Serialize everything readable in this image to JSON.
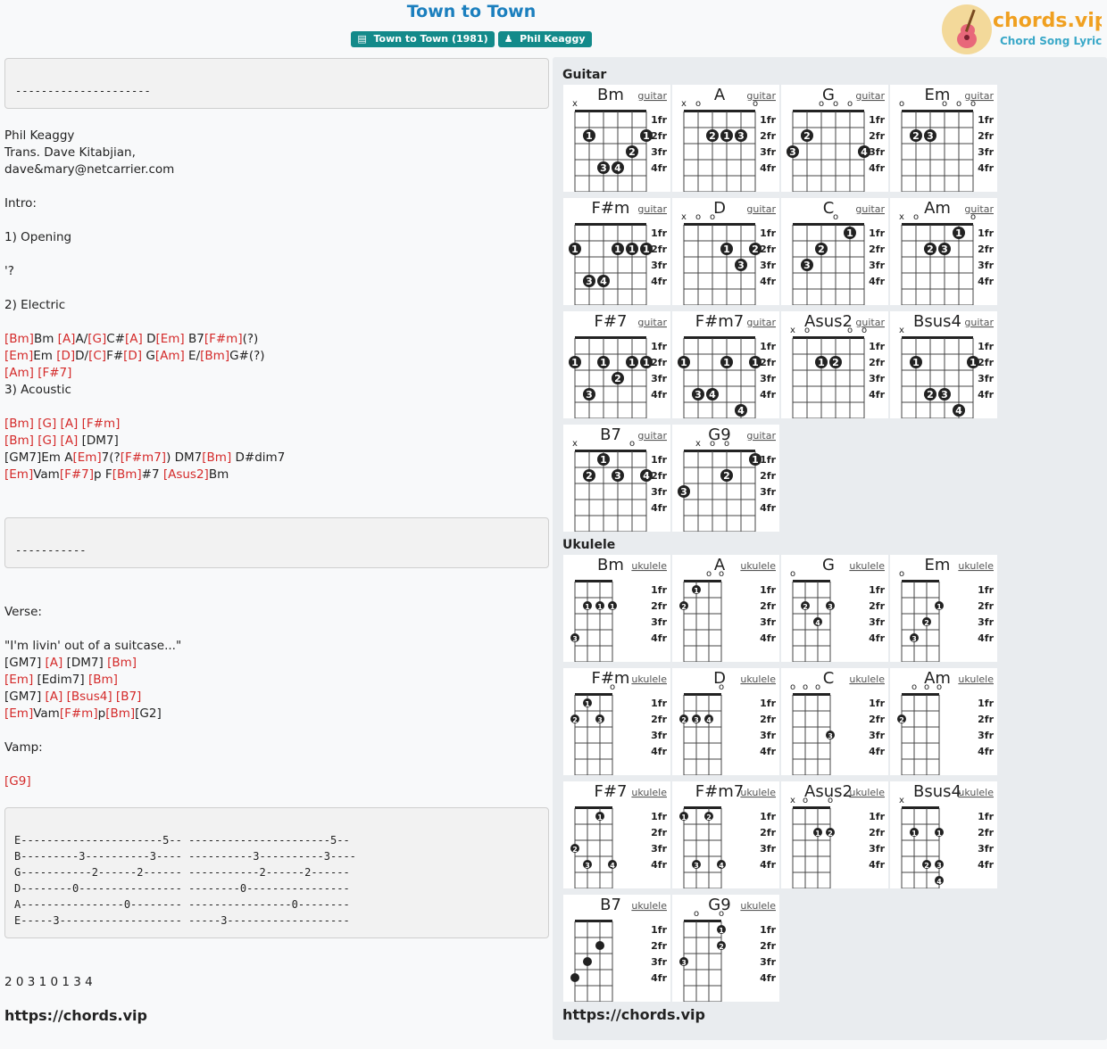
{
  "page": {
    "title": "Town to Town",
    "badges": [
      "Town to Town (1981)",
      "Phil Keaggy"
    ],
    "logo": {
      "name": "chords.vip",
      "tagline": "Chord Song Lyric"
    },
    "footer_url": "https://chords.vip"
  },
  "content": {
    "box1": "---------------------",
    "header_lines": [
      "Phil Keaggy",
      "Trans. Dave Kitabjian,",
      "dave&mary@netcarrier.com",
      "",
      "Intro:",
      "",
      "1) Opening",
      "",
      "'?",
      "",
      "2) Electric"
    ],
    "intro_chord_lines": [
      [
        [
          "[Bm]",
          1
        ],
        [
          "Bm ",
          0
        ],
        [
          "[A]",
          1
        ],
        [
          "A/",
          0
        ],
        [
          "[G]",
          1
        ],
        [
          "C#",
          0
        ],
        [
          "[A]",
          1
        ],
        [
          " D",
          0
        ],
        [
          "[Em]",
          1
        ],
        [
          " B7",
          0
        ],
        [
          "[F#m]",
          1
        ],
        [
          "(?)",
          0
        ]
      ],
      [
        [
          "[Em]",
          1
        ],
        [
          "Em ",
          0
        ],
        [
          "[D]",
          1
        ],
        [
          "D/",
          0
        ],
        [
          "[C]",
          1
        ],
        [
          "F#",
          0
        ],
        [
          "[D]",
          1
        ],
        [
          " G",
          0
        ],
        [
          "[Am]",
          1
        ],
        [
          " E/",
          0
        ],
        [
          "[Bm]",
          1
        ],
        [
          "G#(?)",
          0
        ]
      ],
      [
        [
          "[Am]",
          1
        ],
        [
          " ",
          0
        ],
        [
          "[F#7]",
          1
        ]
      ],
      [
        [
          "3) Acoustic",
          0
        ]
      ],
      [
        [
          "",
          0
        ]
      ],
      [
        [
          "[Bm]",
          1
        ],
        [
          " ",
          0
        ],
        [
          "[G]",
          1
        ],
        [
          " ",
          0
        ],
        [
          "[A]",
          1
        ],
        [
          " ",
          0
        ],
        [
          "[F#m]",
          1
        ]
      ],
      [
        [
          "[Bm]",
          1
        ],
        [
          " ",
          0
        ],
        [
          "[G]",
          1
        ],
        [
          " ",
          0
        ],
        [
          "[A]",
          1
        ],
        [
          " [DM7]",
          0
        ]
      ],
      [
        [
          "[GM7]Em A",
          0
        ],
        [
          "[Em]",
          1
        ],
        [
          "7(?",
          0
        ],
        [
          "[F#m7]",
          1
        ],
        [
          ") DM7",
          0
        ],
        [
          "[Bm]",
          1
        ],
        [
          " D#dim7",
          0
        ]
      ],
      [
        [
          "[Em]",
          1
        ],
        [
          "Vam",
          0
        ],
        [
          "[F#7]",
          1
        ],
        [
          "p F",
          0
        ],
        [
          "[Bm]",
          1
        ],
        [
          "#7 ",
          0
        ],
        [
          "[Asus2]",
          1
        ],
        [
          "Bm",
          0
        ]
      ]
    ],
    "box2": "-----------",
    "verse_lines": [
      [
        [
          "Verse:",
          0
        ]
      ],
      [
        [
          "",
          0
        ]
      ],
      [
        [
          "\"I'm livin' out of a suitcase...\"",
          0
        ]
      ],
      [
        [
          "[GM7] ",
          0
        ],
        [
          "[A]",
          1
        ],
        [
          " [DM7] ",
          0
        ],
        [
          "[Bm]",
          1
        ]
      ],
      [
        [
          "[Em]",
          1
        ],
        [
          " [Edim7] ",
          0
        ],
        [
          "[Bm]",
          1
        ]
      ],
      [
        [
          "[GM7] ",
          0
        ],
        [
          "[A]",
          1
        ],
        [
          " ",
          0
        ],
        [
          "[Bsus4]",
          1
        ],
        [
          " ",
          0
        ],
        [
          "[B7]",
          1
        ]
      ],
      [
        [
          "[Em]",
          1
        ],
        [
          "Vam",
          0
        ],
        [
          "[F#m]",
          1
        ],
        [
          "p",
          0
        ],
        [
          "[Bm]",
          1
        ],
        [
          "[G2]",
          0
        ]
      ],
      [
        [
          "",
          0
        ]
      ],
      [
        [
          "Vamp:",
          0
        ]
      ],
      [
        [
          "",
          0
        ]
      ],
      [
        [
          "[G9]",
          1
        ]
      ]
    ],
    "tab": [
      "E----------------------5-- ----------------------5--",
      "B---------3----------3---- ----------3----------3----",
      "G-----------2------2------ -----------2------2------",
      "D--------0---------------- --------0----------------",
      "A----------------0-------- ----------------0--------",
      "E-----3------------------- -----3-------------------"
    ],
    "fingering": "2 0 3 1 0 1 3 4"
  },
  "diagrams": {
    "guitar_label": "Guitar",
    "ukulele_label": "Ukulele",
    "fret_labels": [
      "1fr",
      "2fr",
      "3fr",
      "4fr"
    ],
    "guitar_link": "guitar",
    "ukulele_link": "ukulele",
    "guitar": [
      {
        "name": "Bm",
        "top": [
          "x",
          "",
          "",
          "",
          "",
          ""
        ],
        "dots": [
          [
            1,
            1,
            "1"
          ],
          [
            1,
            5,
            "1"
          ],
          [
            2,
            4,
            "2"
          ],
          [
            3,
            2,
            "3"
          ],
          [
            3,
            3,
            "4"
          ]
        ]
      },
      {
        "name": "A",
        "top": [
          "x",
          "o",
          "",
          "",
          "",
          "o"
        ],
        "dots": [
          [
            1,
            2,
            "2"
          ],
          [
            1,
            3,
            "1"
          ],
          [
            1,
            4,
            "3"
          ]
        ]
      },
      {
        "name": "G",
        "top": [
          "",
          "",
          "o",
          "o",
          "o",
          ""
        ],
        "dots": [
          [
            1,
            1,
            "2"
          ],
          [
            2,
            0,
            "3"
          ],
          [
            2,
            5,
            "4"
          ]
        ]
      },
      {
        "name": "Em",
        "top": [
          "o",
          "",
          "",
          "o",
          "o",
          "o"
        ],
        "dots": [
          [
            1,
            1,
            "2"
          ],
          [
            1,
            2,
            "3"
          ]
        ]
      },
      {
        "name": "F#m",
        "top": [
          "",
          "",
          "",
          "",
          "",
          ""
        ],
        "dots": [
          [
            1,
            0,
            "1"
          ],
          [
            1,
            3,
            "1"
          ],
          [
            1,
            4,
            "1"
          ],
          [
            1,
            5,
            "1"
          ],
          [
            3,
            1,
            "3"
          ],
          [
            3,
            2,
            "4"
          ]
        ]
      },
      {
        "name": "D",
        "top": [
          "x",
          "o",
          "o",
          "",
          "",
          ""
        ],
        "dots": [
          [
            1,
            3,
            "1"
          ],
          [
            1,
            5,
            "2"
          ],
          [
            2,
            4,
            "3"
          ]
        ]
      },
      {
        "name": "C",
        "top": [
          "",
          "",
          "",
          "o",
          "",
          ""
        ],
        "dots": [
          [
            0,
            4,
            "1"
          ],
          [
            1,
            2,
            "2"
          ],
          [
            2,
            1,
            "3"
          ]
        ]
      },
      {
        "name": "Am",
        "top": [
          "x",
          "o",
          "",
          "",
          "",
          "o"
        ],
        "dots": [
          [
            0,
            4,
            "1"
          ],
          [
            1,
            2,
            "2"
          ],
          [
            1,
            3,
            "3"
          ]
        ]
      },
      {
        "name": "F#7",
        "top": [
          "",
          "",
          "",
          "",
          "",
          ""
        ],
        "dots": [
          [
            1,
            0,
            "1"
          ],
          [
            1,
            2,
            "1"
          ],
          [
            1,
            4,
            "1"
          ],
          [
            1,
            5,
            "1"
          ],
          [
            2,
            3,
            "2"
          ],
          [
            3,
            1,
            "3"
          ]
        ]
      },
      {
        "name": "F#m7",
        "top": [
          "",
          "",
          "",
          "",
          "",
          ""
        ],
        "dots": [
          [
            1,
            0,
            "1"
          ],
          [
            1,
            3,
            "1"
          ],
          [
            1,
            5,
            "1"
          ],
          [
            3,
            1,
            "3"
          ],
          [
            3,
            2,
            "4"
          ],
          [
            4,
            4,
            "4"
          ]
        ]
      },
      {
        "name": "Asus2",
        "top": [
          "x",
          "o",
          "",
          "",
          "o",
          "o"
        ],
        "dots": [
          [
            1,
            2,
            "1"
          ],
          [
            1,
            3,
            "2"
          ]
        ]
      },
      {
        "name": "Bsus4",
        "top": [
          "x",
          "",
          "",
          "",
          "",
          ""
        ],
        "dots": [
          [
            1,
            1,
            "1"
          ],
          [
            1,
            5,
            "1"
          ],
          [
            3,
            2,
            "2"
          ],
          [
            3,
            3,
            "3"
          ],
          [
            4,
            4,
            "4"
          ]
        ]
      },
      {
        "name": "B7",
        "top": [
          "x",
          "",
          "",
          "",
          "o",
          ""
        ],
        "dots": [
          [
            0,
            2,
            "1"
          ],
          [
            1,
            1,
            "2"
          ],
          [
            1,
            3,
            "3"
          ],
          [
            1,
            5,
            "4"
          ]
        ]
      },
      {
        "name": "G9",
        "top": [
          "",
          "x",
          "o",
          "o",
          "",
          ""
        ],
        "dots": [
          [
            0,
            5,
            "1"
          ],
          [
            1,
            3,
            "2"
          ],
          [
            2,
            0,
            "3"
          ]
        ]
      }
    ],
    "ukulele": [
      {
        "name": "Bm",
        "top": [
          "",
          "",
          "",
          ""
        ],
        "dots": [
          [
            1,
            1,
            "1"
          ],
          [
            1,
            2,
            "1"
          ],
          [
            1,
            3,
            "1"
          ],
          [
            3,
            0,
            "3"
          ]
        ]
      },
      {
        "name": "A",
        "top": [
          "",
          "",
          "o",
          "o"
        ],
        "dots": [
          [
            0,
            1,
            "1"
          ],
          [
            1,
            0,
            "2"
          ]
        ]
      },
      {
        "name": "G",
        "top": [
          "o",
          "",
          "",
          ""
        ],
        "dots": [
          [
            1,
            1,
            "2"
          ],
          [
            1,
            3,
            "3"
          ],
          [
            2,
            2,
            "4"
          ]
        ]
      },
      {
        "name": "Em",
        "top": [
          "o",
          "",
          "",
          ""
        ],
        "dots": [
          [
            1,
            3,
            "1"
          ],
          [
            2,
            2,
            "2"
          ],
          [
            3,
            1,
            "3"
          ]
        ]
      },
      {
        "name": "F#m",
        "top": [
          "",
          "",
          "",
          "o"
        ],
        "dots": [
          [
            0,
            1,
            "1"
          ],
          [
            1,
            0,
            "2"
          ],
          [
            1,
            2,
            "3"
          ]
        ]
      },
      {
        "name": "D",
        "top": [
          "",
          "",
          "",
          "o"
        ],
        "dots": [
          [
            1,
            0,
            "2"
          ],
          [
            1,
            1,
            "3"
          ],
          [
            1,
            2,
            "4"
          ]
        ]
      },
      {
        "name": "C",
        "top": [
          "o",
          "o",
          "o",
          ""
        ],
        "dots": [
          [
            2,
            3,
            "3"
          ]
        ]
      },
      {
        "name": "Am",
        "top": [
          "",
          "o",
          "o",
          "o"
        ],
        "dots": [
          [
            1,
            0,
            "2"
          ]
        ]
      },
      {
        "name": "F#7",
        "top": [
          "",
          "",
          "",
          ""
        ],
        "dots": [
          [
            0,
            2,
            "1"
          ],
          [
            2,
            0,
            "2"
          ],
          [
            3,
            1,
            "3"
          ],
          [
            3,
            3,
            "4"
          ]
        ]
      },
      {
        "name": "F#m7",
        "top": [
          "",
          "",
          "",
          ""
        ],
        "dots": [
          [
            0,
            0,
            "1"
          ],
          [
            0,
            2,
            "2"
          ],
          [
            3,
            1,
            "3"
          ],
          [
            3,
            3,
            "4"
          ]
        ]
      },
      {
        "name": "Asus2",
        "top": [
          "x",
          "o",
          "",
          "o"
        ],
        "dots": [
          [
            1,
            2,
            "1"
          ],
          [
            1,
            3,
            "2"
          ]
        ]
      },
      {
        "name": "Bsus4",
        "top": [
          "x",
          "",
          "",
          ""
        ],
        "dots": [
          [
            1,
            1,
            "1"
          ],
          [
            1,
            5,
            "1"
          ],
          [
            3,
            2,
            "2"
          ],
          [
            3,
            3,
            "3"
          ],
          [
            4,
            4,
            "4"
          ]
        ]
      },
      {
        "name": "B7",
        "top": [
          "",
          "",
          "",
          ""
        ],
        "dots": [
          [
            1,
            2,
            ""
          ],
          [
            2,
            1,
            ""
          ],
          [
            3,
            0,
            ""
          ]
        ]
      },
      {
        "name": "G9",
        "top": [
          "",
          "o",
          "",
          "o"
        ],
        "dots": [
          [
            0,
            5,
            "1"
          ],
          [
            1,
            3,
            "2"
          ],
          [
            2,
            0,
            "3"
          ]
        ]
      }
    ]
  }
}
